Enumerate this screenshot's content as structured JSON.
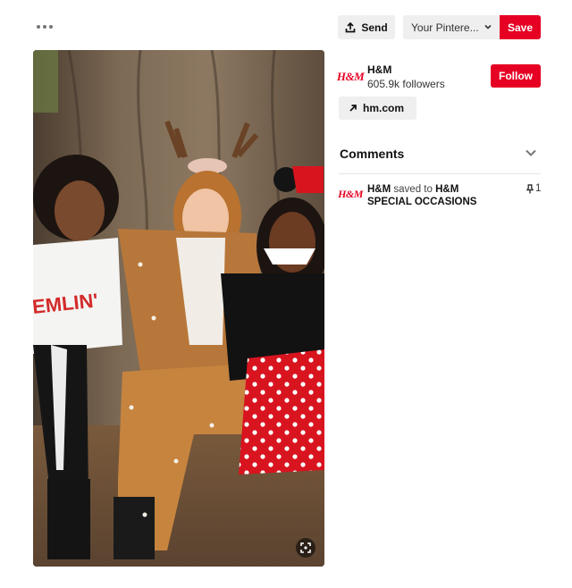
{
  "toolbar": {
    "more_icon": "ellipsis-icon",
    "send_label": "Send",
    "send_icon": "share-upload-icon",
    "board_select_value": "Your Pintere...",
    "save_label": "Save"
  },
  "pin": {
    "fullscreen_icon": "lens-expand-icon"
  },
  "brand": {
    "logo_text": "H&M",
    "name": "H&M",
    "followers": "605.9k followers",
    "follow_label": "Follow",
    "site_link": "hm.com",
    "site_link_icon": "arrow-up-right-icon"
  },
  "comments": {
    "title": "Comments",
    "chevron_icon": "chevron-down-icon"
  },
  "activity": {
    "logo_text": "H&M",
    "user": "H&M",
    "verb": "saved to",
    "board_owner": "H&M",
    "board": "SPECIAL OCCASIONS",
    "pin_count": "1",
    "pin_icon": "pushpin-icon"
  },
  "colors": {
    "brand_red": "#e60023",
    "button_gray": "#efefef",
    "text": "#111111"
  }
}
